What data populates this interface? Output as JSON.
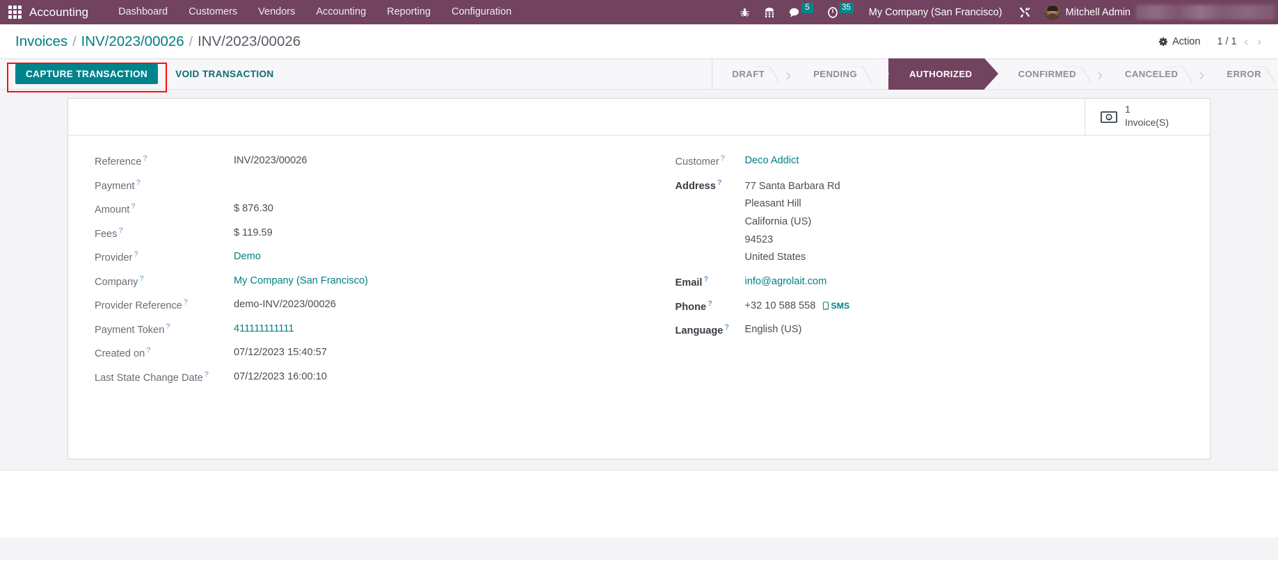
{
  "navbar": {
    "apps_icon": "grid-apps-icon",
    "brand": "Accounting",
    "menu": [
      {
        "label": "Dashboard"
      },
      {
        "label": "Customers"
      },
      {
        "label": "Vendors"
      },
      {
        "label": "Accounting"
      },
      {
        "label": "Reporting"
      },
      {
        "label": "Configuration"
      }
    ],
    "systray": {
      "debug_icon": "bug-icon",
      "voip_icon": "dialpad-icon",
      "messages_icon": "chat-bubble-icon",
      "messages_count": "5",
      "activities_icon": "clock-icon",
      "activities_count": "35",
      "company": "My Company (San Francisco)",
      "tools_icon": "wrench-screwdriver-icon",
      "user": "Mitchell Admin"
    }
  },
  "controlpanel": {
    "breadcrumb": {
      "root": "Invoices",
      "sep": "/",
      "parent": "INV/2023/00026",
      "current": "INV/2023/00026"
    },
    "action": {
      "icon": "gear-icon",
      "label": "Action"
    },
    "pager": {
      "value": "1 / 1",
      "prev": "‹",
      "next": "›"
    },
    "buttons": {
      "capture": "CAPTURE TRANSACTION",
      "void": "VOID TRANSACTION"
    },
    "highlight_color": "#fc0d0d",
    "statusbar": {
      "active": "AUTHORIZED",
      "stages": [
        {
          "label": "DRAFT"
        },
        {
          "label": "PENDING"
        },
        {
          "label": "AUTHORIZED"
        },
        {
          "label": "CONFIRMED"
        },
        {
          "label": "CANCELED"
        },
        {
          "label": "ERROR"
        }
      ]
    }
  },
  "sheet": {
    "smart_button": {
      "icon": "money-bill-icon",
      "value": "1",
      "label": "Invoice(S)"
    },
    "left_fields": [
      {
        "label": "Reference",
        "value": "INV/2023/00026",
        "link": false,
        "bold": false
      },
      {
        "label": "Payment",
        "value": "",
        "link": false,
        "bold": false
      },
      {
        "label": "Amount",
        "value": "$ 876.30",
        "link": false,
        "bold": false
      },
      {
        "label": "Fees",
        "value": "$ 119.59",
        "link": false,
        "bold": false
      },
      {
        "label": "Provider",
        "value": "Demo",
        "link": true,
        "bold": false
      },
      {
        "label": "Company",
        "value": "My Company (San Francisco)",
        "link": true,
        "bold": false
      },
      {
        "label": "Provider Reference",
        "value": "demo-INV/2023/00026",
        "link": false,
        "bold": false
      },
      {
        "label": "Payment Token",
        "value": "411111111111",
        "link": true,
        "bold": false
      },
      {
        "label": "Created on",
        "value": "07/12/2023 15:40:57",
        "link": false,
        "bold": false
      },
      {
        "label": "Last State Change Date",
        "value": "07/12/2023 16:00:10",
        "link": false,
        "bold": false
      }
    ],
    "right_fields": {
      "customer_label": "Customer",
      "customer_value": "Deco Addict",
      "address_label": "Address",
      "address_lines": [
        "77 Santa Barbara Rd",
        "Pleasant Hill",
        "California (US)",
        "94523",
        "United States"
      ],
      "email_label": "Email",
      "email_value": "info@agrolait.com",
      "phone_label": "Phone",
      "phone_value": "+32 10 588 558",
      "sms_label": "SMS",
      "sms_icon": "mobile-phone-icon",
      "language_label": "Language",
      "language_value": "English (US)"
    },
    "tooltip_marker": "?"
  },
  "colors": {
    "navbar_bg": "#71435f",
    "primary_teal": "#00848c",
    "link_teal": "#017e84",
    "badge_teal": "#00868a",
    "active_stage": "#71435f",
    "content_bg": "#f4f4f7"
  }
}
